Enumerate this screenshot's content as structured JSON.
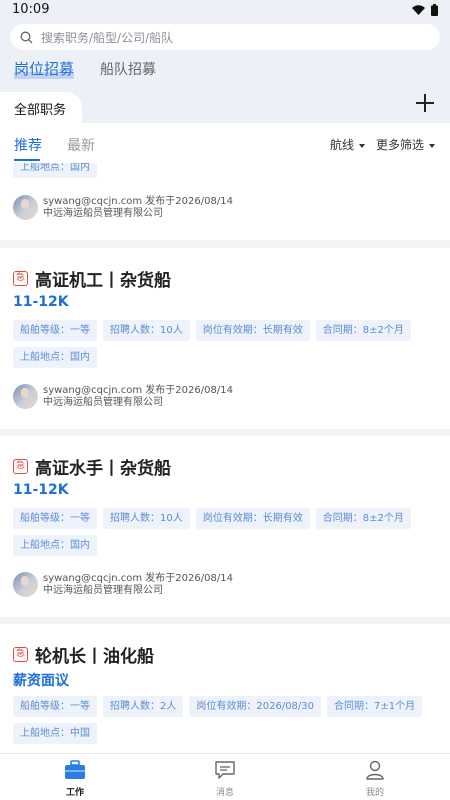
{
  "status": {
    "time": "10:09"
  },
  "search": {
    "placeholder": "搜索职务/船型/公司/船队"
  },
  "main_tabs": [
    {
      "label": "岗位招募",
      "active": true
    },
    {
      "label": "船队招募",
      "active": false
    }
  ],
  "category": {
    "label": "全部职务"
  },
  "sub_tabs": [
    {
      "label": "推荐",
      "active": true
    },
    {
      "label": "最新",
      "active": false
    }
  ],
  "filters": {
    "route": "航线",
    "more": "更多筛选"
  },
  "partial_card": {
    "tag": "上船地点：国内",
    "poster": "sywang@cqcjn.com 发布于2026/08/14",
    "company": "中远海运船员管理有限公司"
  },
  "jobs": [
    {
      "urgent": "急",
      "title": "高证机工丨杂货船",
      "salary": "11-12K",
      "tags": [
        "船舶等级：一等",
        "招聘人数：10人",
        "岗位有效期：长期有效",
        "合同期：8±2个月",
        "上船地点：国内"
      ],
      "poster": "sywang@cqcjn.com 发布于2026/08/14",
      "company": "中远海运船员管理有限公司"
    },
    {
      "urgent": "急",
      "title": "高证水手丨杂货船",
      "salary": "11-12K",
      "tags": [
        "船舶等级：一等",
        "招聘人数：10人",
        "岗位有效期：长期有效",
        "合同期：8±2个月",
        "上船地点：国内"
      ],
      "poster": "sywang@cqcjn.com 发布于2026/08/14",
      "company": "中远海运船员管理有限公司"
    },
    {
      "urgent": "急",
      "title": "轮机长丨油化船",
      "salary": "薪资面议",
      "tags": [
        "船舶等级：一等",
        "招聘人数：2人",
        "岗位有效期：2026/08/30",
        "合同期：7±1个月",
        "上船地点：中国"
      ],
      "poster": "",
      "company": ""
    }
  ],
  "tabbar": [
    {
      "label": "工作",
      "icon": "briefcase-icon",
      "active": true
    },
    {
      "label": "消息",
      "icon": "message-icon",
      "active": false
    },
    {
      "label": "我的",
      "icon": "profile-icon",
      "active": false
    }
  ],
  "colors": {
    "accent": "#1e6fd9",
    "urgent": "#e5483c",
    "tag_bg": "#eef3fb",
    "tag_text": "#5b8cd1"
  }
}
